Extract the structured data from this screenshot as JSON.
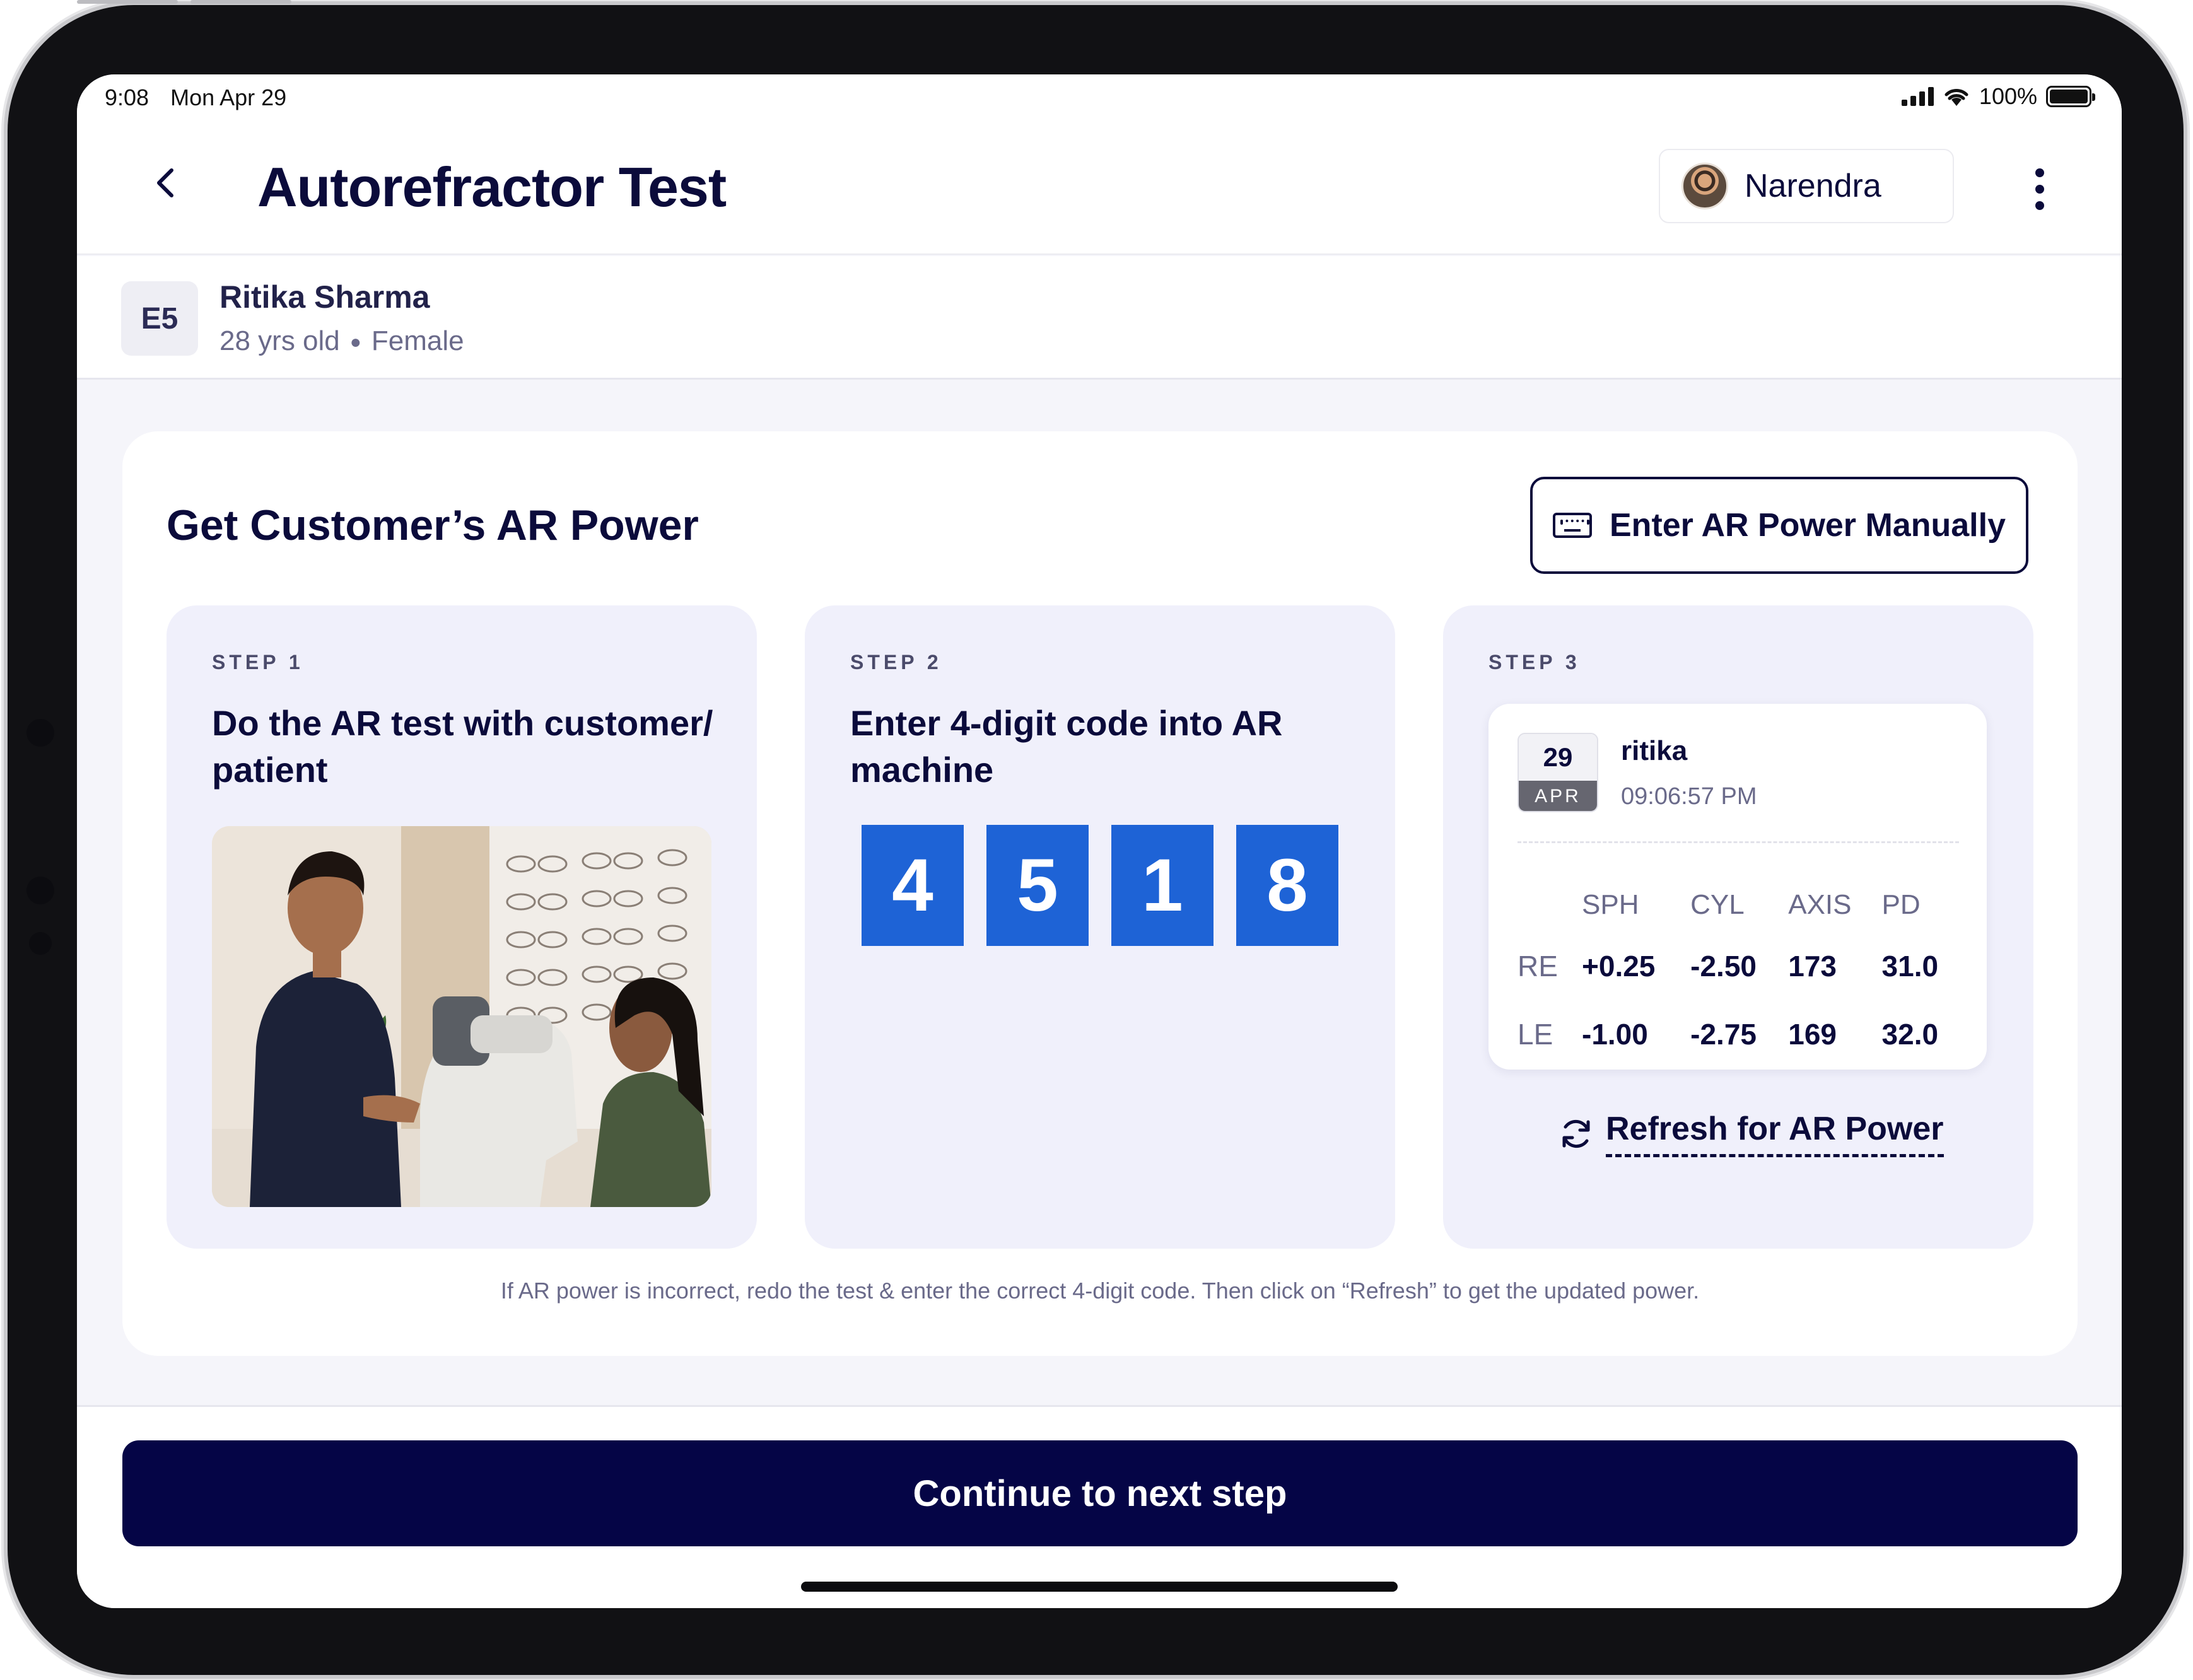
{
  "status_bar": {
    "time": "9:08",
    "date": "Mon Apr 29",
    "battery": "100%"
  },
  "header": {
    "title": "Autorefractor Test",
    "user_name": "Narendra"
  },
  "patient": {
    "code": "E5",
    "name": "Ritika Sharma",
    "age": "28 yrs old",
    "gender": "Female"
  },
  "card": {
    "title": "Get Customer’s AR Power",
    "manual_button": "Enter AR Power Manually",
    "hint": "If AR power is incorrect, redo the test & enter the correct 4-digit code. Then click on “Refresh” to get the updated power."
  },
  "steps": [
    {
      "label": "STEP 1",
      "text": "Do the AR test with customer/ patient"
    },
    {
      "label": "STEP 2",
      "text": "Enter 4-digit code into AR machine",
      "code": [
        "4",
        "5",
        "1",
        "8"
      ]
    },
    {
      "label": "STEP 3"
    }
  ],
  "result": {
    "day": "29",
    "month": "APR",
    "name": "ritika",
    "time": "09:06:57 PM",
    "columns": [
      "SPH",
      "CYL",
      "AXIS",
      "PD"
    ],
    "rows": [
      {
        "eye": "RE",
        "sph": "+0.25",
        "cyl": "-2.50",
        "axis": "173",
        "pd": "31.0"
      },
      {
        "eye": "LE",
        "sph": "-1.00",
        "cyl": "-2.75",
        "axis": "169",
        "pd": "32.0"
      }
    ],
    "refresh_label": "Refresh for AR Power"
  },
  "footer": {
    "continue_label": "Continue to next step"
  },
  "colors": {
    "navy": "#0b0b3b",
    "continue_bg": "#050546",
    "code_box": "#1e63d6",
    "step_bg": "#f0f0fb"
  }
}
